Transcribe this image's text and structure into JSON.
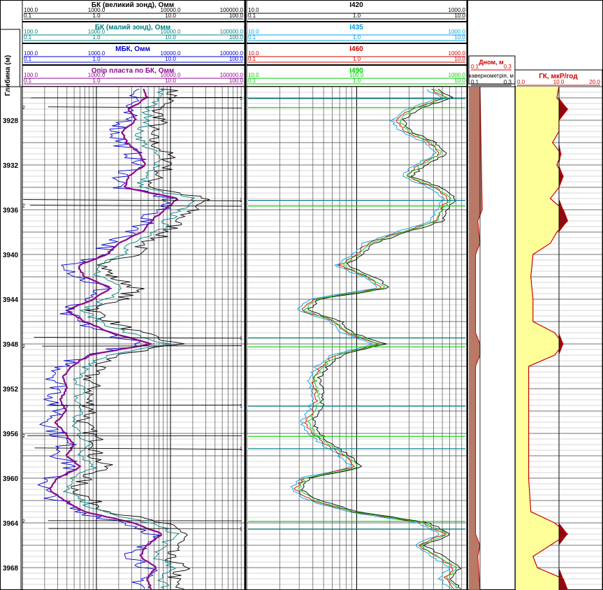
{
  "depth_header": "Глибина (м)",
  "depth_ticks": [
    3928,
    3932,
    3936,
    3940,
    3944,
    3948,
    3952,
    3956,
    3960,
    3964,
    3968
  ],
  "tracks": {
    "resistivity": {
      "curves": [
        {
          "name": "БК (великий зонд), Омм",
          "color": "#000000",
          "scale": [
            "100.0",
            "1000.0",
            "10000.0",
            "100000.0"
          ],
          "scale2": [
            "0.1",
            "1.0",
            "10.0",
            "100.0"
          ]
        },
        {
          "name": "БК (малий зонд), Омм",
          "color": "#008080",
          "scale": [
            "100.0",
            "1000.0",
            "10000.0",
            "100000.0"
          ],
          "scale2": [
            "0.1",
            "1.0",
            "10.0",
            "100.0"
          ]
        },
        {
          "name": "МБК, Омм",
          "color": "#0000cc",
          "scale": [
            "100.0",
            "1000.0",
            "10000.0",
            "100000.0"
          ],
          "scale2": [
            "0.1",
            "1.0",
            "10.0",
            "100.0"
          ]
        },
        {
          "name": "Опір пласта по БК, Омм",
          "color": "#8b0a8b",
          "scale": [
            "100.0",
            "1000.0",
            "10000.0",
            "100000.0"
          ],
          "scale2": [
            "0.1",
            "1.0",
            "10.0",
            "100.0"
          ]
        }
      ]
    },
    "induction": {
      "curves": [
        {
          "name": "I420",
          "color": "#000000",
          "scale": [
            "10.0",
            "1000.0"
          ],
          "scale2": [
            "0.1",
            "1.0",
            "10.0"
          ]
        },
        {
          "name": "I435",
          "color": "#00a0e0",
          "scale": [
            "10.0",
            "1000.0"
          ],
          "scale2": [
            "0.1",
            "1.0",
            "10.0"
          ]
        },
        {
          "name": "I460",
          "color": "#cc0000",
          "scale": [
            "10.0",
            "1000.0"
          ],
          "scale2": [
            "0.1",
            "1.0",
            "10.0"
          ]
        },
        {
          "name": "I490",
          "color": "#00cc00",
          "scale": [
            "10.0",
            "100.0",
            "1000.0"
          ],
          "scale2": [
            "0.1",
            "1.0",
            "10.0"
          ]
        }
      ]
    },
    "caliper": {
      "title": "Дном, м",
      "scale": [
        "0.1",
        "0.3"
      ],
      "title2": "кавернометрія, м",
      "scale2": [
        "0.1",
        "0.3"
      ],
      "color": "#cc0000"
    },
    "gamma": {
      "title": "ГК, мкР/год",
      "scale": [
        "0.0",
        "10.0",
        "20.0"
      ],
      "color": "#cc0000"
    }
  },
  "chart_data": {
    "type": "well-log",
    "depth_unit": "м",
    "depth_range": [
      3925,
      3970
    ],
    "caliper_series": {
      "depth": [
        3925,
        3936,
        3937,
        3939,
        3940,
        3947,
        3948,
        3949,
        3950,
        3965,
        3966,
        3967,
        3970
      ],
      "value": [
        0.15,
        0.16,
        0.14,
        0.15,
        0.13,
        0.13,
        0.15,
        0.15,
        0.13,
        0.13,
        0.15,
        0.14,
        0.15
      ]
    },
    "gamma_series": {
      "depth": [
        3925,
        3926,
        3927,
        3928,
        3929,
        3930,
        3931,
        3932,
        3933,
        3934,
        3935,
        3936,
        3937,
        3938,
        3939,
        3940,
        3942,
        3944,
        3946,
        3947,
        3948,
        3949,
        3950,
        3952,
        3956,
        3960,
        3963,
        3964,
        3965,
        3966,
        3967,
        3968,
        3969,
        3970
      ],
      "value": [
        10,
        9.5,
        12,
        10,
        10,
        8.5,
        10.5,
        9.5,
        11,
        10,
        8,
        11,
        12,
        9.5,
        8,
        4,
        3.5,
        4,
        4,
        9,
        11,
        9,
        3,
        3,
        3,
        3,
        3.5,
        9,
        12,
        8,
        4,
        5,
        11,
        12
      ]
    },
    "tadpole_labels": [
      "1",
      "2"
    ]
  }
}
